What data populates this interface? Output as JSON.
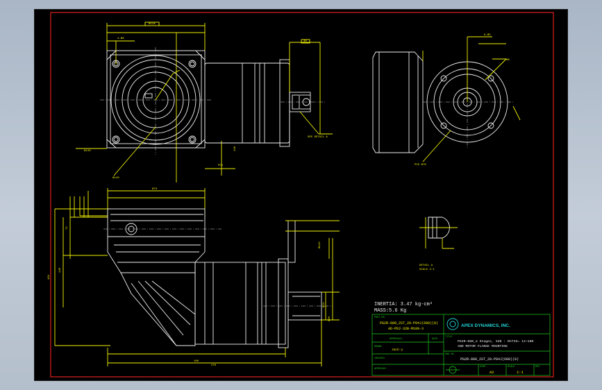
{
  "notes": {
    "inertia": "INERTIA: 3.47 kg-cm²",
    "mass": "MASS:5.6 Kg"
  },
  "title_block": {
    "part_no_label": "PART NO",
    "part_no_line1": "PG2R-080_2ST_28-P04J(600)(0)",
    "part_no_line2": "AD-PE2-32B-M100-3",
    "approval_label": "APPROVALL",
    "date_label": "DATE",
    "drawn_label": "DRAWN",
    "drawn_value": "Jack-y",
    "checked_label": "CHECKED",
    "approved_label": "APPROVED",
    "company": "APEX DYNAMICS, INC.",
    "title_label": "TITLE",
    "title_line1": "PG2R-080_2 Stages, 32B : RATIO= 12~100",
    "title_line2": "AND MOTOR FLANGE MOUNTING",
    "dwg_no_label": "DWG NO",
    "dwg_no_value": "PG2R-080_2ST_28-P04J(600)(0)",
    "size_label": "SIZE",
    "size_value": "A2",
    "scale_label": "SCALE",
    "scale_value": "1:1",
    "rev_label": "REV"
  },
  "callouts": {
    "tap_note": "SEE DETAIL A",
    "pcd": "PCD Ø70",
    "detail": "DETAIL A",
    "detail_scale": "SCALE 2:1"
  }
}
